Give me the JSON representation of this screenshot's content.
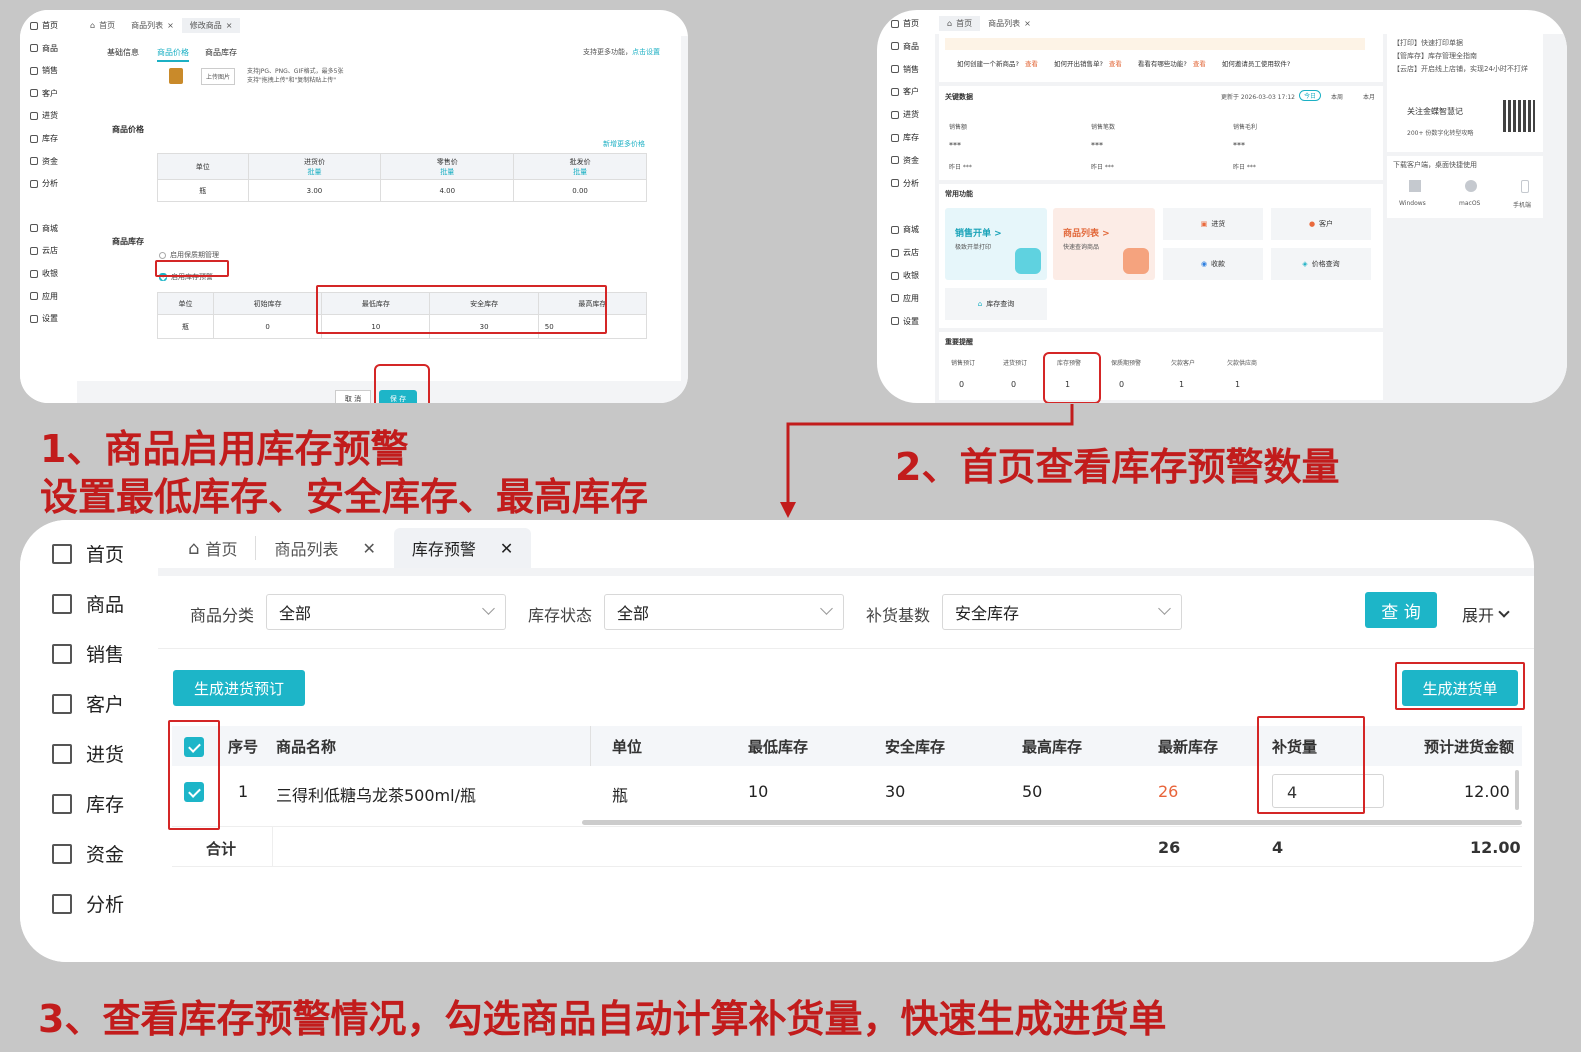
{
  "captions": {
    "step1_line1": "1、商品启用库存预警",
    "step1_line2": "设置最低库存、安全库存、最高库存",
    "step2": "2、首页查看库存预警数量",
    "step3": "3、查看库存预警情况，勾选商品自动计算补货量，快速生成进货单"
  },
  "shot1": {
    "sidebar": [
      "首页",
      "商品",
      "销售",
      "客户",
      "进货",
      "库存",
      "资金",
      "分析",
      "商城",
      "云店",
      "收银",
      "应用",
      "设置"
    ],
    "tabs": [
      "首页",
      "商品列表",
      "修改商品"
    ],
    "subtabs": [
      "基础信息",
      "商品价格",
      "商品库存"
    ],
    "more_func": "支持更多功能，",
    "more_link": "点击设置",
    "upload_btn": "上传图片",
    "upload_hint1": "支持JPG、PNG、GIF格式，最多5张",
    "upload_hint2": "支持\"拖拽上传\"和\"复制粘贴上传\"",
    "price_title": "商品价格",
    "add_price": "新增更多价格",
    "price_headers": [
      "单位",
      "进货价",
      "零售价",
      "批发价"
    ],
    "batch": "批量",
    "price_row": [
      "瓶",
      "3.00",
      "4.00",
      "0.00"
    ],
    "stock_title": "商品库存",
    "opt_expiry": "启用保质期管理",
    "opt_warning": "启用库存预警",
    "stock_headers": [
      "单位",
      "初始库存",
      "最低库存",
      "安全库存",
      "最高库存"
    ],
    "stock_row": [
      "瓶",
      "0",
      "10",
      "30",
      "50"
    ],
    "cancel": "取 消",
    "save": "保 存"
  },
  "shot2": {
    "sidebar": [
      "首页",
      "商品",
      "销售",
      "客户",
      "进货",
      "库存",
      "资金",
      "分析",
      "商城",
      "云店",
      "收银",
      "应用",
      "设置"
    ],
    "tabs": [
      "首页",
      "商品列表"
    ],
    "faq": [
      "如何创建一个新商品?",
      "查看",
      "如何开出销售单?",
      "查看",
      "看看有哪些功能?",
      "查看",
      "如何邀请员工使用软件?"
    ],
    "key_data": "关键数据",
    "updated": "更新于 2026-03-03 17:12",
    "periods": [
      "今日",
      "本周",
      "本月"
    ],
    "metrics": [
      {
        "label": "销售额",
        "value": "***",
        "sub": "昨日 ***"
      },
      {
        "label": "销售笔数",
        "value": "***",
        "sub": "昨日 ***"
      },
      {
        "label": "销售毛利",
        "value": "***",
        "sub": "昨日 ***"
      }
    ],
    "common": "常用功能",
    "f_sales": "销售开单 >",
    "f_sales_sub": "极致开单打印",
    "f_list": "商品列表 >",
    "f_list_sub": "快速查询商品",
    "f_buy": "进货",
    "f_cust": "客户",
    "f_recv": "收款",
    "f_price": "价格查询",
    "f_stock": "库存查询",
    "reminder": "重要提醒",
    "rem_labels": [
      "销售预订",
      "进货预订",
      "库存预警",
      "保质期预警",
      "欠款客户",
      "欠款供应商"
    ],
    "rem_values": [
      "0",
      "0",
      "1",
      "0",
      "1",
      "1"
    ],
    "right_news": [
      "【打印】快速打印单据",
      "【管库存】库存管理全指南",
      "【云店】开启线上店铺，实现24小时不打烊"
    ],
    "follow": "关注金蝶智慧记",
    "follow_sub": "200+ 份数字化转型攻略",
    "download": "下载客户端，桌面快捷使用",
    "platforms": [
      "Windows",
      "macOS",
      "手机端"
    ]
  },
  "shot3": {
    "sidebar": [
      "首页",
      "商品",
      "销售",
      "客户",
      "进货",
      "库存",
      "资金",
      "分析"
    ],
    "tabs": [
      "首页",
      "商品列表",
      "库存预警"
    ],
    "filter_labels": [
      "商品分类",
      "库存状态",
      "补货基数"
    ],
    "filter_values": [
      "全部",
      "全部",
      "安全库存"
    ],
    "query": "查 询",
    "expand": "展开",
    "gen_order_pre": "生成进货预订",
    "gen_order": "生成进货单",
    "headers": [
      "序号",
      "商品名称",
      "单位",
      "最低库存",
      "安全库存",
      "最高库存",
      "最新库存",
      "补货量",
      "预计进货金额"
    ],
    "row": [
      "1",
      "三得利低糖乌龙茶500ml/瓶",
      "瓶",
      "10",
      "30",
      "50",
      "26",
      "4",
      "12.00"
    ],
    "total_label": "合计",
    "totals": [
      "26",
      "4",
      "12.00"
    ]
  },
  "colors": {
    "accent": "#1db5c8",
    "caption": "#c21c1c",
    "warning_value": "#e8643a"
  }
}
